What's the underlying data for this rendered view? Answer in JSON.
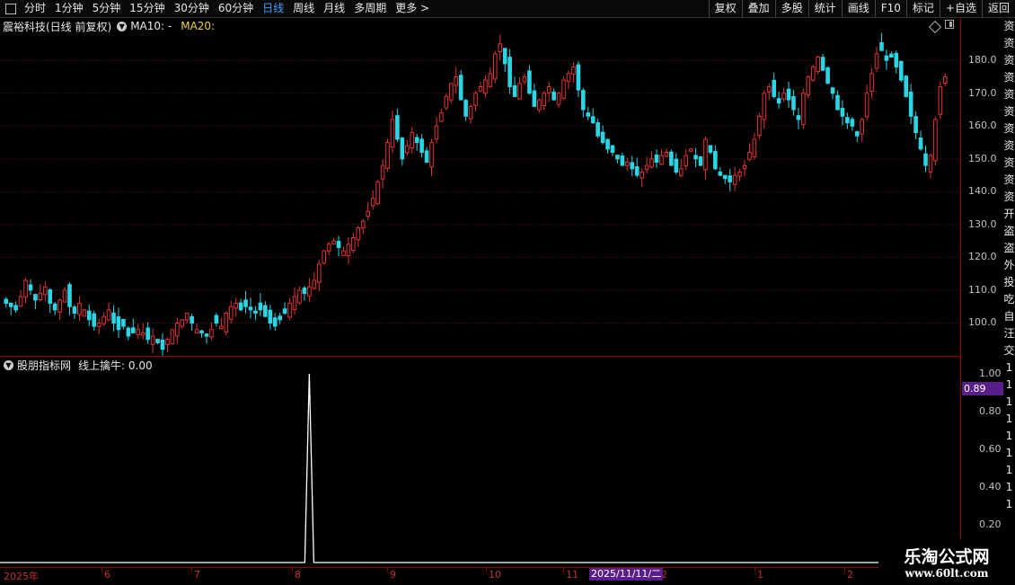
{
  "toolbar": {
    "periods": [
      "分时",
      "1分钟",
      "5分钟",
      "15分钟",
      "30分钟",
      "60分钟",
      "日线",
      "周线",
      "月线",
      "多周期",
      "更多 >"
    ],
    "active_period": "日线",
    "right_buttons": [
      "复权",
      "叠加",
      "多股",
      "统计",
      "画线",
      "F10",
      "标记",
      "+自选",
      "返回"
    ]
  },
  "main_chart": {
    "title": "震裕科技(日线 前复权)",
    "ma10_label": "MA10: -",
    "ma20_label": "MA20:",
    "price_ticks": [
      "180.0",
      "170.0",
      "160.0",
      "150.0",
      "140.0",
      "130.0",
      "120.0",
      "110.0",
      "100.0"
    ]
  },
  "indicator": {
    "name": "股朋指标网",
    "line_label": "线上擒牛: 0.00",
    "ticks": [
      "1.00",
      "0.80",
      "0.60",
      "0.40",
      "0.20"
    ],
    "current_value": "0.89"
  },
  "date_axis": {
    "labels": [
      "2025年",
      "6",
      "7",
      "8",
      "9",
      "10",
      "11",
      "2",
      "1",
      "2"
    ],
    "current_date": "2025/11/11/二"
  },
  "side_strip": [
    "资",
    "资",
    "资",
    "资",
    "资",
    "资",
    "资",
    "资",
    "资",
    "资",
    "资",
    "开",
    "盗",
    "盗",
    "外",
    "投",
    "吃",
    "",
    "",
    "自",
    "汪",
    "交",
    "1",
    "1",
    "1",
    "1",
    "1",
    "1",
    "1",
    "1",
    "1"
  ],
  "watermark": {
    "title": "乐淘公式网",
    "url": "www.60lt.com"
  },
  "colors": {
    "up": "#e03434",
    "down": "#29d6e6",
    "grid": "#5a1414",
    "axis": "#8b0000",
    "ma20": "#e8d040",
    "highlight": "#5a1e8a"
  },
  "chart_data": {
    "type": "candlestick",
    "y_range": [
      90,
      188
    ],
    "closes": [
      106,
      105,
      104,
      108,
      113,
      110,
      107,
      109,
      111,
      106,
      104,
      107,
      110,
      105,
      103,
      106,
      104,
      101,
      99,
      100,
      102,
      104,
      100,
      98,
      99,
      96,
      97,
      98,
      97,
      95,
      96,
      94,
      92,
      95,
      98,
      100,
      101,
      103,
      100,
      98,
      97,
      96,
      98,
      100,
      99,
      103,
      105,
      106,
      104,
      105,
      104,
      103,
      104,
      102,
      100,
      99,
      101,
      103,
      106,
      108,
      110,
      109,
      111,
      113,
      118,
      122,
      124,
      125,
      123,
      122,
      124,
      126,
      129,
      131,
      134,
      138,
      143,
      148,
      155,
      162,
      156,
      150,
      154,
      158,
      155,
      152,
      149,
      155,
      160,
      164,
      169,
      173,
      175,
      168,
      163,
      166,
      170,
      172,
      174,
      176,
      182,
      185,
      179,
      172,
      169,
      173,
      175,
      170,
      166,
      168,
      170,
      172,
      168,
      170,
      174,
      176,
      178,
      171,
      165,
      163,
      161,
      157,
      155,
      153,
      152,
      150,
      148,
      149,
      147,
      145,
      146,
      148,
      150,
      149,
      151,
      152,
      148,
      146,
      147,
      151,
      153,
      150,
      148,
      156,
      152,
      147,
      145,
      144,
      143,
      145,
      146,
      148,
      152,
      156,
      163,
      170,
      172,
      169,
      167,
      170,
      168,
      165,
      162,
      170,
      175,
      178,
      181,
      177,
      173,
      170,
      165,
      163,
      161,
      160,
      157,
      162,
      170,
      176,
      182,
      183,
      180,
      181,
      178,
      174,
      169,
      163,
      158,
      153,
      148,
      151,
      162,
      172,
      175
    ],
    "indicator_spike_index": 62,
    "indicator_spike_value": 1.0
  }
}
